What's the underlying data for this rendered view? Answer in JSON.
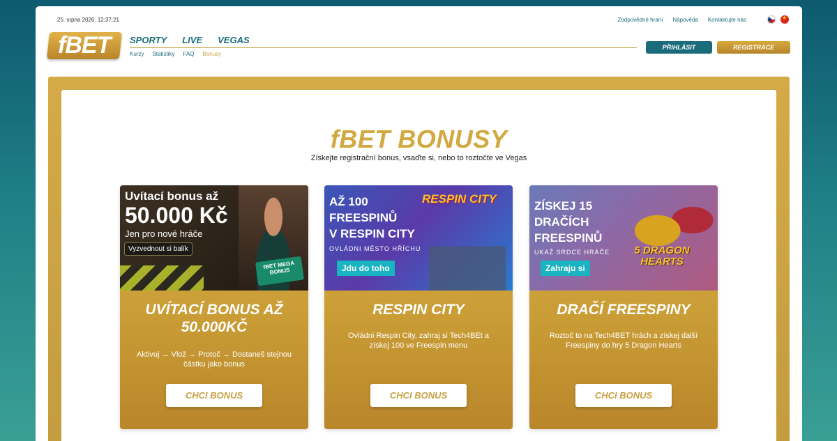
{
  "topbar": {
    "datetime": "25. srpna 2026, 12:37:21",
    "links": [
      "Zodpovědné hraní",
      "Nápověda",
      "Kontaktujte nás"
    ]
  },
  "header": {
    "logo": "fBET",
    "mainnav": [
      "SPORTY",
      "LIVE",
      "VEGAS"
    ],
    "subnav": [
      "Kurzy",
      "Statistiky",
      "FAQ",
      "Bonusy"
    ],
    "active_subnav": "Bonusy",
    "login": "PŘIHLÁSIT",
    "register": "REGISTRACE"
  },
  "main": {
    "title": "fBET BONUSY",
    "subtitle": "Získejte registrační bonus, vsaďte si, nebo to roztočte ve Vegas"
  },
  "cards": [
    {
      "banner": {
        "l1": "Uvítací bonus až",
        "l2": "50.000 Kč",
        "l3": "Jen pro nové hráče",
        "cta": "Vyzvednout si balík",
        "badge": "fBET MEGA BONUS"
      },
      "title": "UVÍTACÍ BONUS AŽ 50.000KČ",
      "text": "Aktivuj → Vlož → Protoč → Dostaneš stejnou částku jako bonus",
      "button": "CHCI BONUS"
    },
    {
      "banner": {
        "l1": "AŽ 100",
        "l2": "FREESPINŮ",
        "l3": "V RESPIN CITY",
        "l4": "OVLÁDNI MĚSTO HŘÍCHU",
        "cta": "Jdu do toho",
        "game": "RESPIN CITY"
      },
      "title": "RESPIN CITY",
      "text": "Ovládni Respin City, zahraj si Tech4BEt a získej 100 ve Freespin menu",
      "button": "CHCI BONUS"
    },
    {
      "banner": {
        "l1": "ZÍSKEJ 15",
        "l2": "DRAČÍCH",
        "l3": "FREESPINŮ",
        "l4": "UKAŽ SRDCE HRÁČE",
        "cta": "Zahraju si",
        "game": "5 DRAGON HEARTS"
      },
      "title": "DRAČÍ FREESPINY",
      "text": "Roztoč to na Tech4BET hrách a získej další Freespiny do hry 5 Dragon Hearts",
      "button": "CHCI BONUS"
    }
  ],
  "colors": {
    "teal": "#1a6c7a",
    "gold": "#d2a840",
    "cta_teal": "#19b3c2"
  }
}
